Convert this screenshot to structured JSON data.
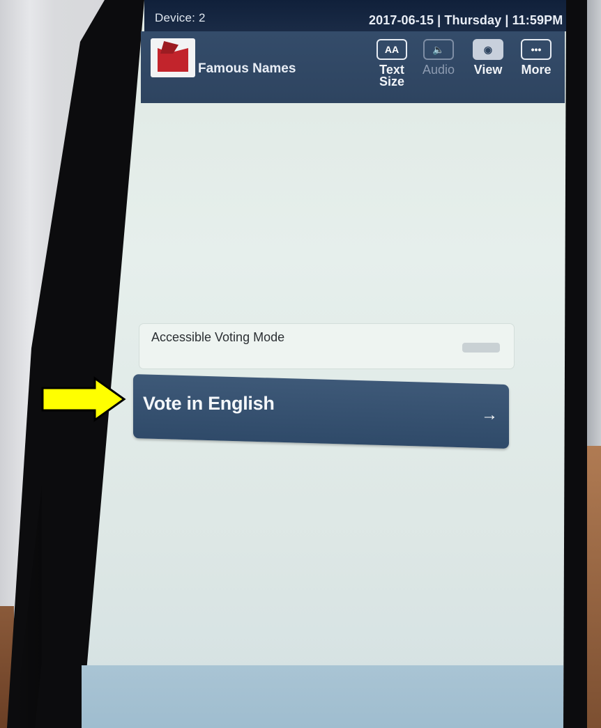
{
  "status_bar": {
    "device": "Device: 2",
    "datetime": "2017-06-15 | Thursday | 11:59PM"
  },
  "header": {
    "app_name": "Famous Names",
    "logo_icon": "ballot-box-logo",
    "tools": [
      {
        "label_line1": "Text",
        "label_line2": "Size",
        "icon": "text-size-icon",
        "glyph": "AA"
      },
      {
        "label_line1": "Audio",
        "label_line2": "",
        "icon": "speaker-icon",
        "glyph": "🔈"
      },
      {
        "label_line1": "View",
        "label_line2": "",
        "icon": "eye-icon",
        "glyph": "◉"
      },
      {
        "label_line1": "More",
        "label_line2": "",
        "icon": "more-icon",
        "glyph": "•••"
      }
    ]
  },
  "main": {
    "accessible_mode_label": "Accessible Voting Mode",
    "vote_button_label": "Vote in English",
    "vote_button_arrow": "→"
  },
  "colors": {
    "header_bg": "#344c6a",
    "status_bg": "#10203a",
    "vote_button_bg": "#3a5574",
    "screen_bg": "#e2ebe8",
    "pointer_fill": "#ffff00",
    "footer_bg": "#a9c4d4",
    "logo_red": "#c2242c"
  }
}
